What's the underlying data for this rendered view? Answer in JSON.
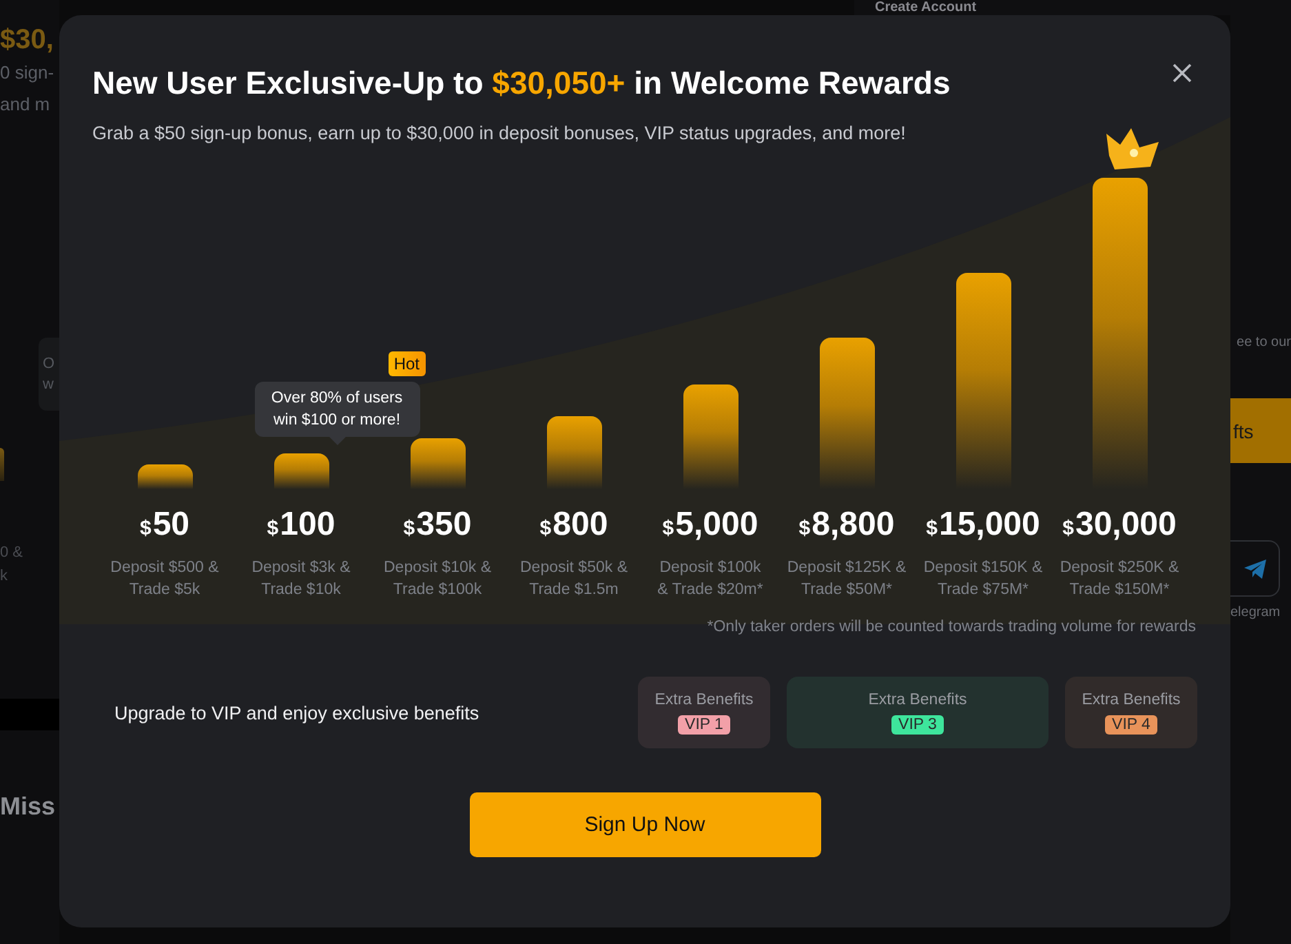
{
  "background_page": {
    "headline": "$30,",
    "intro_lines": [
      "0 sign-",
      "and m"
    ],
    "card_lines": [
      "O",
      "w"
    ],
    "tier_lines": [
      "0 &",
      "k"
    ],
    "section_title": "Miss",
    "form_title": "Create Account",
    "agree_text": "ee to our",
    "submit_button": "fts",
    "social_label": "elegram"
  },
  "modal": {
    "title_start": "New User Exclusive-Up to ",
    "title_highlight": "$30,050+",
    "title_end": " in Welcome Rewards",
    "subtitle": "Grab a $50 sign-up bonus, earn up to $30,000 in deposit bonuses, VIP status upgrades, and more!",
    "tiers": [
      {
        "currency": "$",
        "amount": "50",
        "requirement": [
          "Deposit $500 &",
          "Trade $5k"
        ]
      },
      {
        "currency": "$",
        "amount": "100",
        "requirement": [
          "Deposit $3k &",
          "Trade $10k"
        ],
        "tooltip": {
          "text": "Over 80% of users win $100 or more!",
          "badge": "Hot"
        }
      },
      {
        "currency": "$",
        "amount": "350",
        "requirement": [
          "Deposit $10k &",
          "Trade $100k"
        ]
      },
      {
        "currency": "$",
        "amount": "800",
        "requirement": [
          "Deposit $50k &",
          "Trade $1.5m"
        ]
      },
      {
        "currency": "$",
        "amount": "5,000",
        "requirement": [
          "Deposit $100k",
          "& Trade $20m*"
        ]
      },
      {
        "currency": "$",
        "amount": "8,800",
        "requirement": [
          "Deposit $125K &",
          "Trade $50M*"
        ]
      },
      {
        "currency": "$",
        "amount": "15,000",
        "requirement": [
          "Deposit $150K &",
          "Trade $75M*"
        ]
      },
      {
        "currency": "$",
        "amount": "30,000",
        "requirement": [
          "Deposit $250K &",
          "Trade $150M*"
        ]
      }
    ],
    "footnote": "*Only taker orders will be counted towards trading volume for rewards",
    "vip_prompt": "Upgrade to VIP and enjoy exclusive benefits",
    "vip_cards": [
      {
        "label": "Extra Benefits",
        "badge": "VIP 1",
        "color": "#f2a0a8",
        "kind": "narrow"
      },
      {
        "label": "Extra Benefits",
        "badge": "VIP 3",
        "color": "#3ee59c",
        "kind": "wide"
      },
      {
        "label": "Extra Benefits",
        "badge": "VIP 4",
        "color": "#e8935a",
        "kind": "narrow"
      }
    ],
    "cta": "Sign Up Now"
  }
}
